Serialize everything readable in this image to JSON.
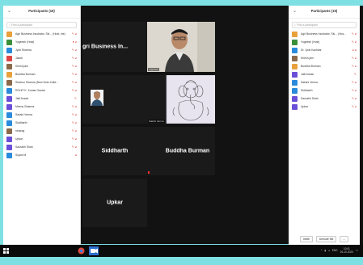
{
  "left_panel": {
    "title": "Participants (19)",
    "search_placeholder": "Find a participant",
    "participants": [
      {
        "name": "Agri Business Incubator, Ski... (Host, me)",
        "color": "#e8a13c",
        "icons": "✎ ⌀"
      },
      {
        "name": "Yogeesh (Host)",
        "color": "#3a8f3a",
        "icons": "● ⌀"
      },
      {
        "name": "Jyoti Sharma",
        "color": "#2a8adb",
        "icons": "✎ ⌀"
      },
      {
        "name": "Jakob",
        "color": "#d44",
        "icons": "✎ ⌀"
      },
      {
        "name": "Khesh jain",
        "color": "#8a6a4a",
        "icons": "✎ ⌀"
      },
      {
        "name": "Buddha Burman",
        "color": "#e8a13c",
        "icons": "✎ ⌀"
      },
      {
        "name": "Shatrun Sharma (New Nuto Kolkt...",
        "color": "#8a6a4a",
        "icons": "✎ ⌀"
      },
      {
        "name": "ROHIT K. Kumar Gautar",
        "color": "#2a8adb",
        "icons": "✎ ⌀"
      },
      {
        "name": "Jalil Ansari",
        "color": "#6b4fd8",
        "icons": "✎"
      },
      {
        "name": "Meenu Sharma",
        "color": "#6b4fd8",
        "icons": "✎ ⌀"
      },
      {
        "name": "Sakshi Verma",
        "color": "#2a8adb",
        "icons": "✎ ⌀"
      },
      {
        "name": "Siddharth",
        "color": "#2a8adb",
        "icons": "✎ ⌀"
      },
      {
        "name": "ninarag",
        "color": "#8a6a4a",
        "icons": "✎ ⌀"
      },
      {
        "name": "Upkar",
        "color": "#6b4fd8",
        "icons": "✎ ⌀"
      },
      {
        "name": "Saurabh Shah",
        "color": "#6b4fd8",
        "icons": "✎ ⌀"
      },
      {
        "name": "Sujani M",
        "color": "#2a8adb",
        "icons": "⌀"
      }
    ],
    "buttons": [
      "Invite",
      "Unmute Me",
      "..."
    ]
  },
  "right_panel": {
    "title": "Participants (19)",
    "search_placeholder": "Find a participant",
    "participants": [
      {
        "name": "Agri Business Incubator, Ski... (Hos...",
        "color": "#e8a13c",
        "icons": "✎ ⌀"
      },
      {
        "name": "Yogeesh (Host)",
        "color": "#3a8f3a",
        "icons": "✎ ⌀"
      },
      {
        "name": "Dr. Jyoti Kachkar",
        "color": "#2a8adb",
        "icons": "⌀ ⌀"
      },
      {
        "name": "Khesh jain",
        "color": "#8a6a4a",
        "icons": "✎ ⌀"
      },
      {
        "name": "Buddha Burman",
        "color": "#e8a13c",
        "icons": "✎ ⌀"
      },
      {
        "name": "Jalil Ansari",
        "color": "#6b4fd8",
        "icons": "✎"
      },
      {
        "name": "Sakshi Verma",
        "color": "#2a8adb",
        "icons": "✎ ⌀"
      },
      {
        "name": "Siddharth",
        "color": "#2a8adb",
        "icons": "✎ ⌀"
      },
      {
        "name": "Saurabh Shah",
        "color": "#6b4fd8",
        "icons": "✎ ⌀"
      },
      {
        "name": "Upkar",
        "color": "#6b4fd8",
        "icons": "✎ ⌀"
      }
    ],
    "buttons": [
      "Invite",
      "Unmute Me",
      "..."
    ]
  },
  "meeting": {
    "tile_agri": "gri Business In...",
    "tile_video_caption": "Yogeesh",
    "tile_siddharth": "Siddharth",
    "tile_buddha": "Buddha Burman",
    "tile_upkar": "Upkar",
    "tile_sketch_caption": "Sakshi Verma"
  },
  "taskbar": {
    "clock_time": "10:01",
    "clock_date": "26-10-2020",
    "lang": "ENG"
  }
}
